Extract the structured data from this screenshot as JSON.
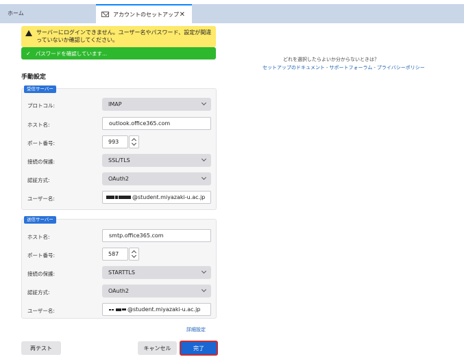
{
  "tabs": {
    "home_label": "ホーム",
    "active_label": "アカウントのセットアップ",
    "close_glyph": "✕"
  },
  "alerts": {
    "warning_text": "サーバーにログインできません。ユーザー名やパスワード、設定が間違っていないか確認してください。",
    "success_text": "パスワードを確認しています..."
  },
  "help": {
    "question": "どれを選択したらよいか分からないときは？",
    "link_docs": "セットアップのドキュメント",
    "link_forum": "サポートフォーラム",
    "link_privacy": "プライバシーポリシー",
    "separator": "-"
  },
  "manual": {
    "title": "手動設定"
  },
  "incoming": {
    "badge": "受信サーバー",
    "protocol_label": "プロトコル:",
    "protocol_value": "IMAP",
    "host_label": "ホスト名:",
    "host_value": "outlook.office365.com",
    "port_label": "ポート番号:",
    "port_value": "993",
    "security_label": "接続の保護:",
    "security_value": "SSL/TLS",
    "auth_label": "認証方式:",
    "auth_value": "OAuth2",
    "user_label": "ユーザー名:",
    "user_value": "@student.miyazaki-u.ac.jp"
  },
  "outgoing": {
    "badge": "送信サーバー",
    "host_label": "ホスト名:",
    "host_value": "smtp.office365.com",
    "port_label": "ポート番号:",
    "port_value": "587",
    "security_label": "接続の保護:",
    "security_value": "STARTTLS",
    "auth_label": "認証方式:",
    "auth_value": "OAuth2",
    "user_label": "ユーザー名:",
    "user_value": "@student.miyazaki-u.ac.jp"
  },
  "advanced_link": "詳細設定",
  "buttons": {
    "retest": "再テスト",
    "cancel": "キャンセル",
    "done": "完了"
  },
  "colors": {
    "warning_bg": "#fde96a",
    "success_bg": "#2eb82e",
    "accent_blue": "#1a66d2",
    "focus_red": "#d12a2a",
    "tab_strip": "#c9d6e8"
  },
  "icons": {
    "warning": "warning-triangle-icon",
    "check": "checkmark-icon",
    "mail": "mail-icon",
    "chevron": "chevron-down-icon",
    "spinner": "spin-arrows-icon"
  }
}
